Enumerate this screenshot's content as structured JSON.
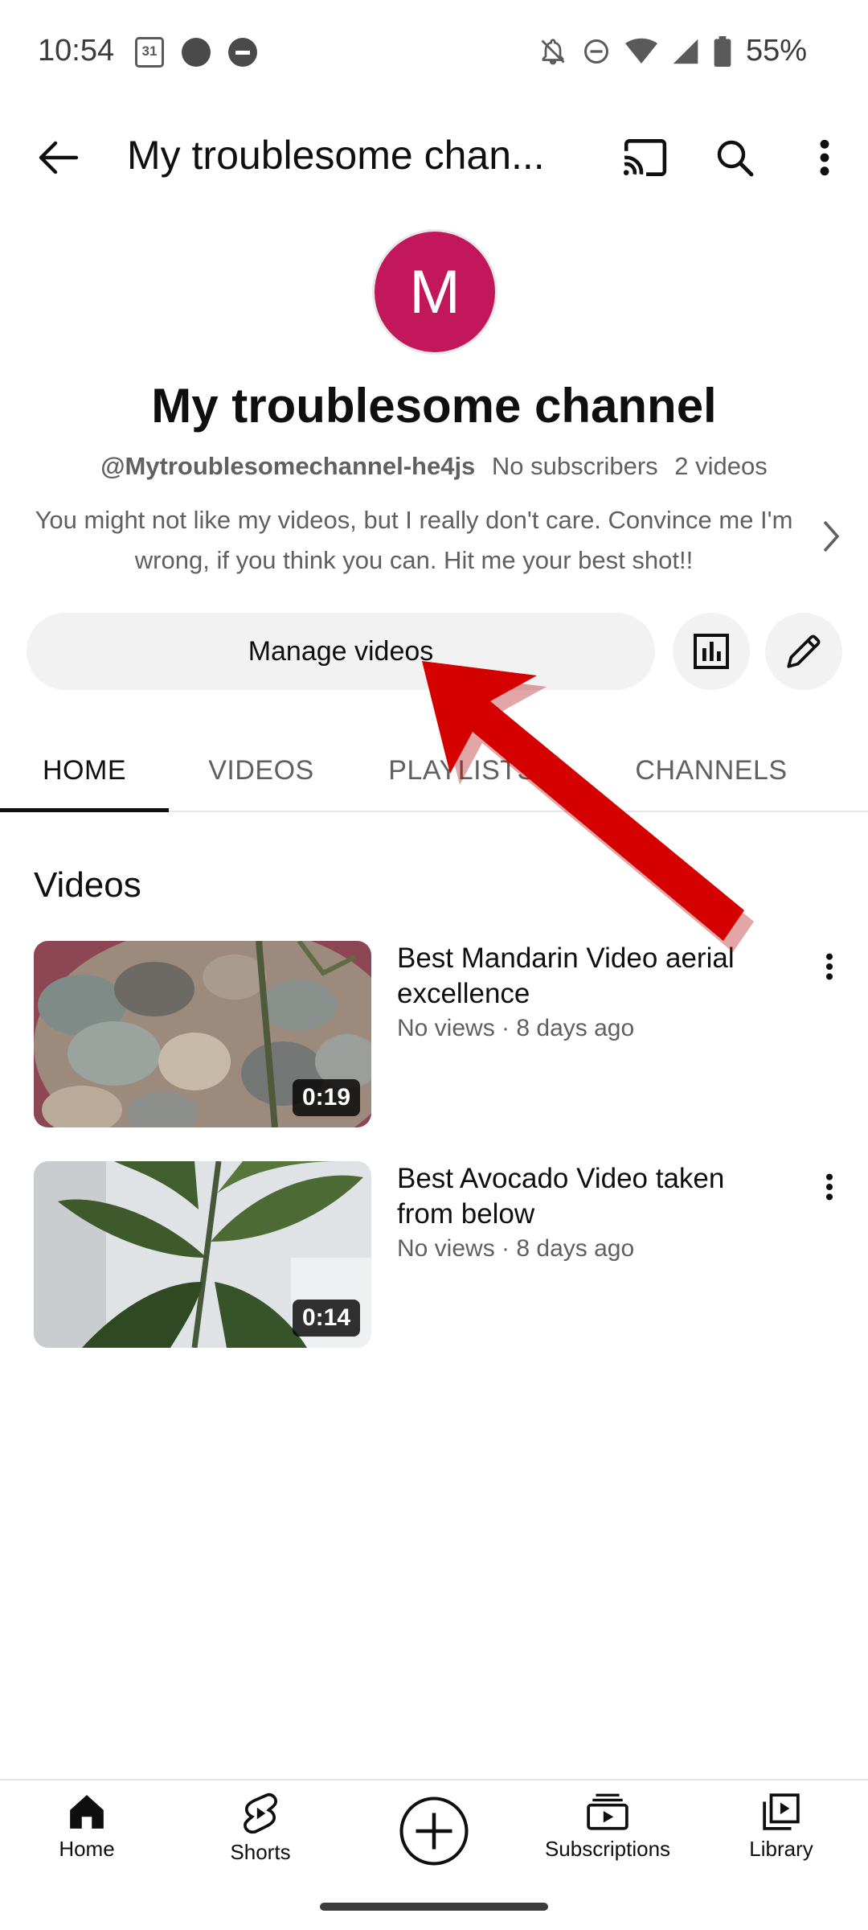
{
  "status_bar": {
    "time": "10:54",
    "calendar_day": "31",
    "battery": "55%"
  },
  "app_bar": {
    "title": "My troublesome chan..."
  },
  "channel": {
    "avatar_letter": "M",
    "avatar_color": "#c2185b",
    "name": "My troublesome channel",
    "handle": "@Mytroublesomechannel-he4js",
    "subscribers": "No subscribers",
    "video_count": "2 videos",
    "description": "You might not like my videos, but I really don't care. Convince me I'm wrong, if you think you can. Hit me your best shot!!"
  },
  "actions": {
    "manage_label": "Manage videos"
  },
  "tabs": [
    {
      "label": "HOME",
      "active": true
    },
    {
      "label": "VIDEOS",
      "active": false
    },
    {
      "label": "PLAYLISTS",
      "active": false
    },
    {
      "label": "CHANNELS",
      "active": false
    }
  ],
  "section": {
    "title": "Videos"
  },
  "videos": [
    {
      "title": "Best Mandarin Video aerial excellence",
      "meta": "No views · 8 days ago",
      "duration": "0:19"
    },
    {
      "title": "Best Avocado Video taken from below",
      "meta": "No views · 8 days ago",
      "duration": "0:14"
    }
  ],
  "bottom_nav": [
    {
      "label": "Home"
    },
    {
      "label": "Shorts"
    },
    {
      "label": "Subscriptions"
    },
    {
      "label": "Library"
    }
  ],
  "colors": {
    "annotation_arrow": "#d50000"
  }
}
